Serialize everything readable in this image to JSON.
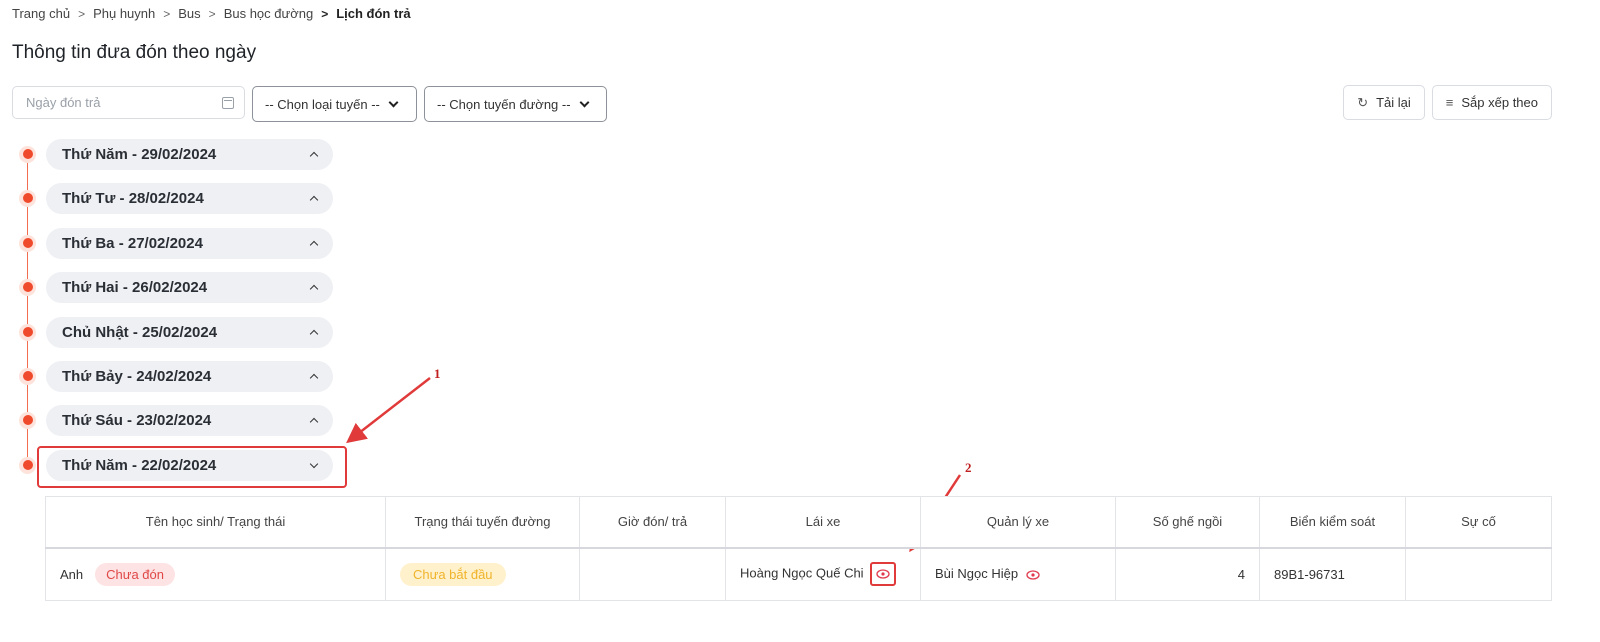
{
  "breadcrumb": {
    "items": [
      "Trang chủ",
      "Phụ huynh",
      "Bus",
      "Bus học đường"
    ],
    "current": "Lịch đón trả",
    "separator": ">"
  },
  "page": {
    "title": "Thông tin đưa đón theo ngày"
  },
  "filters": {
    "date_placeholder": "Ngày đón trả",
    "route_type_selected": "-- Chọn loại tuyến --",
    "route_selected": "-- Chọn tuyến đường --"
  },
  "toolbar": {
    "reload_label": "Tải lại",
    "sort_label": "Sắp xếp theo",
    "reload_icon": "↻",
    "sort_icon": "≡"
  },
  "timeline": {
    "items": [
      {
        "label": "Thứ Năm - 29/02/2024",
        "expanded": false
      },
      {
        "label": "Thứ Tư - 28/02/2024",
        "expanded": false
      },
      {
        "label": "Thứ Ba - 27/02/2024",
        "expanded": false
      },
      {
        "label": "Thứ Hai - 26/02/2024",
        "expanded": false
      },
      {
        "label": "Chủ Nhật - 25/02/2024",
        "expanded": false
      },
      {
        "label": "Thứ Bảy - 24/02/2024",
        "expanded": false
      },
      {
        "label": "Thứ Sáu - 23/02/2024",
        "expanded": false
      },
      {
        "label": "Thứ Năm - 22/02/2024",
        "expanded": true
      }
    ]
  },
  "annotations": {
    "one": "1",
    "two": "2",
    "color": "#e03a3a"
  },
  "table": {
    "headers": [
      "Tên học sinh/ Trạng thái",
      "Trạng thái tuyến đường",
      "Giờ đón/ trả",
      "Lái xe",
      "Quản lý xe",
      "Số ghế ngồi",
      "Biển kiểm soát",
      "Sự cố"
    ],
    "rows": [
      {
        "student": "Anh",
        "student_status": "Chưa đón",
        "route_status": "Chưa bắt đầu",
        "time": "",
        "driver": "Hoàng Ngọc Quế Chi",
        "manager": "Bùi Ngọc Hiệp",
        "seats": "4",
        "plate": "89B1-96731",
        "incident": ""
      }
    ]
  }
}
